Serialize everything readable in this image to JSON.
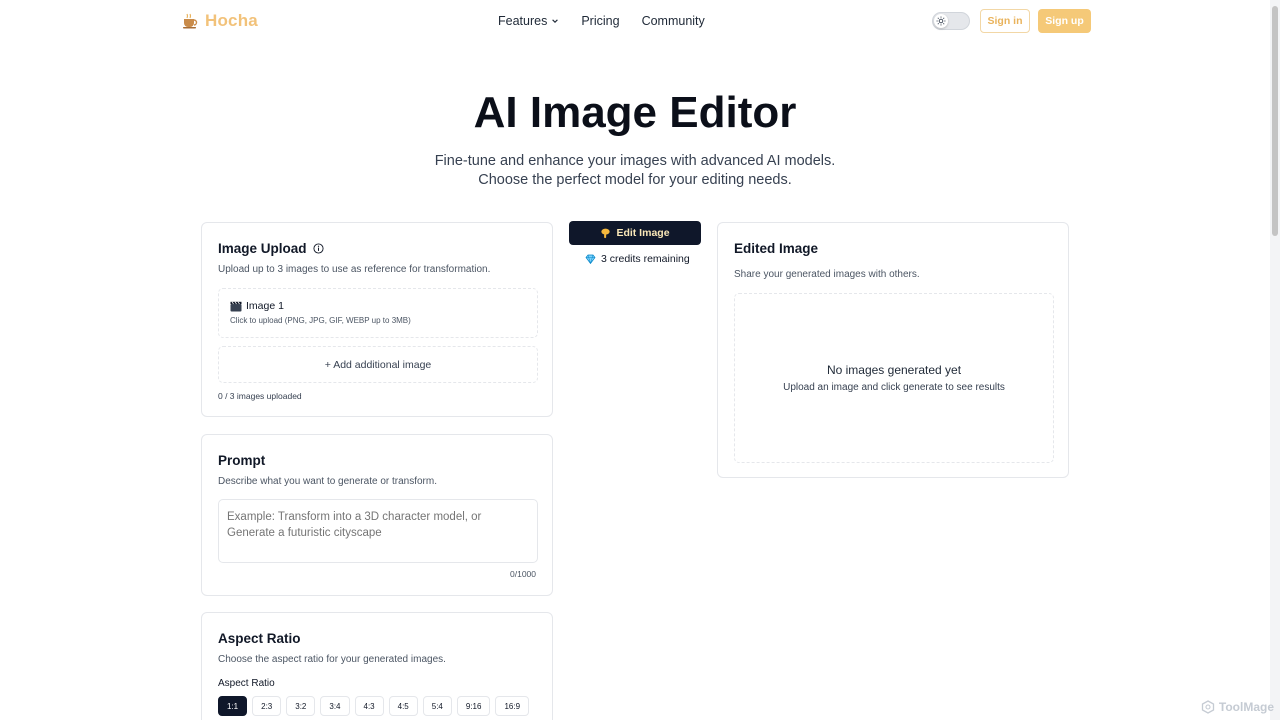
{
  "brand": {
    "name": "Hocha",
    "icon": "tea-cup-icon",
    "color": "#f2c27a"
  },
  "nav": {
    "features": "Features",
    "pricing": "Pricing",
    "community": "Community"
  },
  "auth": {
    "sign_in": "Sign in",
    "sign_up": "Sign up"
  },
  "hero": {
    "title": "AI Image Editor",
    "sub1": "Fine-tune and enhance your images with advanced AI models.",
    "sub2": "Choose the perfect model for your editing needs."
  },
  "upload": {
    "title": "Image Upload",
    "desc": "Upload up to 3 images to use as reference for transformation.",
    "slot1_label": "Image 1",
    "slot1_hint": "Click to upload (PNG, JPG, GIF, WEBP up to 3MB)",
    "add_label": "+ Add additional image",
    "count": "0 / 3 images uploaded"
  },
  "prompt": {
    "title": "Prompt",
    "desc": "Describe what you want to generate or transform.",
    "placeholder": "Example: Transform into a 3D character model, or Generate a futuristic cityscape",
    "count": "0/1000"
  },
  "aspect": {
    "title": "Aspect Ratio",
    "desc": "Choose the aspect ratio for your generated images.",
    "label": "Aspect Ratio",
    "options": [
      "1:1",
      "2:3",
      "3:2",
      "3:4",
      "4:3",
      "4:5",
      "5:4",
      "9:16",
      "16:9"
    ],
    "selected": "1:1"
  },
  "action": {
    "edit_label": "Edit Image",
    "credits": "3 credits remaining"
  },
  "result": {
    "title": "Edited Image",
    "desc": "Share your generated images with others.",
    "empty_title": "No images generated yet",
    "empty_sub": "Upload an image and click generate to see results"
  },
  "watermark": "ToolMage"
}
